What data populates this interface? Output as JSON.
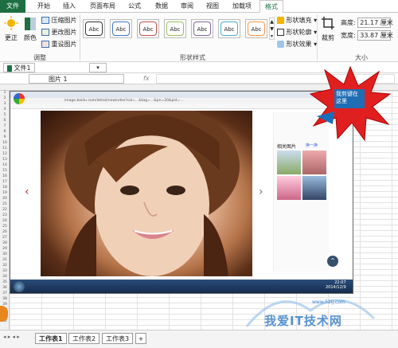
{
  "tabs": [
    "文件",
    "开始",
    "插入",
    "页面布局",
    "公式",
    "数据",
    "审阅",
    "视图",
    "加载项",
    "格式"
  ],
  "ribbon": {
    "adjust": {
      "update_label": "更正",
      "color_label": "颜色",
      "compress": "压缩图片",
      "change": "更改图片",
      "reset": "重设图片",
      "group": "调整"
    },
    "shape_styles": {
      "box_label": "Abc",
      "group": "形状样式",
      "fill": "形状填充",
      "outline": "形状轮廓",
      "effects": "形状效果"
    },
    "size": {
      "crop": "裁剪",
      "height_label": "高度:",
      "height_value": "21.17 厘米",
      "width_label": "宽度:",
      "width_value": "33.87 厘米",
      "group": "大小"
    }
  },
  "doc_tab": "文件1",
  "name_box": "图片 1",
  "fx": "fx",
  "browser": {
    "url": "image.baidu.com/detail/newindex?col=...&tag=...&pn=20&pid=...",
    "side_related": "相关图片",
    "side_next": "换一换"
  },
  "taskbar_time": "22:07",
  "taskbar_date": "2014/12/9",
  "callout": "我剪键在\n这里",
  "sheets": [
    "工作表1",
    "工作表2",
    "工作表3"
  ],
  "watermark": "我爱IT技术网",
  "watermark_url": "www.52ij.com"
}
